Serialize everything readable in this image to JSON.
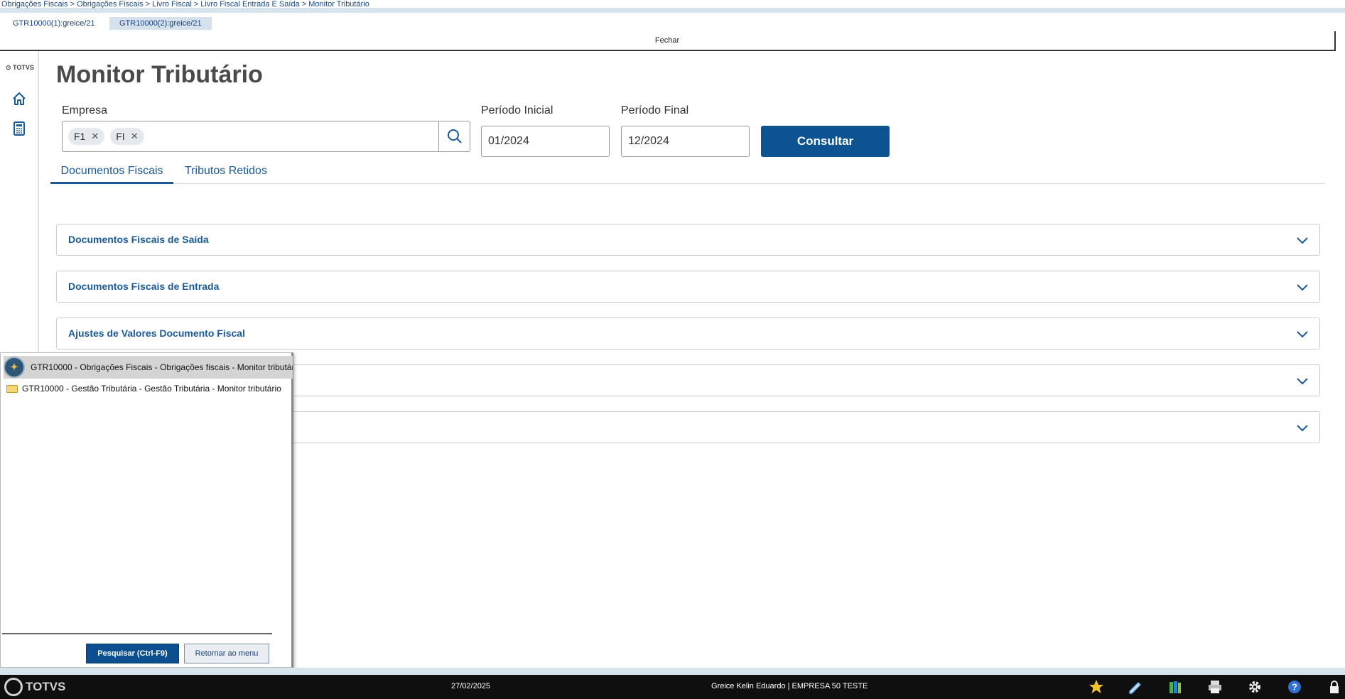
{
  "breadcrumb": "Obrigações Fiscais > Obrigações Fiscais > Livro Fiscal > Livro Fiscal Entrada E Saída > Monitor Tributário",
  "window_tabs": [
    "GTR10000(1):greice/21",
    "GTR10000(2):greice/21"
  ],
  "close_label": "Fechar",
  "sidebar": {
    "logo": "TOTVS",
    "items": [
      "home-icon",
      "calculator-icon"
    ]
  },
  "page_title": "Monitor Tributário",
  "form": {
    "empresa_label": "Empresa",
    "empresa_chips": [
      "F1",
      "FI"
    ],
    "periodo_inicial_label": "Período Inicial",
    "periodo_inicial_value": "01/2024",
    "periodo_final_label": "Período Final",
    "periodo_final_value": "12/2024",
    "consultar_label": "Consultar"
  },
  "tabs": [
    "Documentos Fiscais",
    "Tributos Retidos"
  ],
  "active_tab": "Documentos Fiscais",
  "accordions": [
    "Documentos Fiscais de Saída",
    "Documentos Fiscais de Entrada",
    "Ajustes de Valores Documento Fiscal",
    "",
    ""
  ],
  "popup": {
    "items": [
      "GTR10000 - Obrigações Fiscais - Obrigações fiscais - Monitor tributár",
      "GTR10000 - Gestão Tributária - Gestão Tributária - Monitor tributário"
    ],
    "search_button": "Pesquisar (Ctrl-F9)",
    "return_button": "Retornar ao menu"
  },
  "taskbar": {
    "logo": "TOTVS",
    "date": "27/02/2025",
    "user": "Greice Kelin Eduardo | EMPRESA 50 TESTE",
    "icons": [
      "star-icon",
      "pen-icon",
      "books-icon",
      "printer-icon",
      "gear-icon",
      "help-icon",
      "lock-icon"
    ]
  },
  "colors": {
    "primary": "#0c5391",
    "link": "#1a5a98",
    "taskbar": "#0f0f0f"
  }
}
